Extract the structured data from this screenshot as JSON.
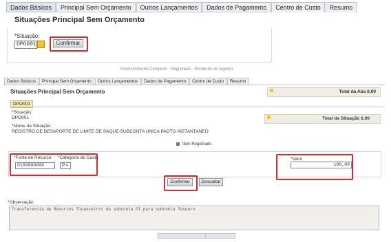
{
  "top": {
    "tabs": [
      "Dados Básicos",
      "Principal Sem Orçamento",
      "Outros Lançamentos",
      "Dados de Pagamento",
      "Centro de Custo",
      "Resumo"
    ],
    "title": "Situações Principal Sem Orçamento",
    "situacao_label": "Situação:",
    "situacao_value": "DPO001",
    "confirm_label": "Confirmar"
  },
  "middle_text": "Preenchimento Completo  ·  Registrado  ·  Pendente de registro",
  "bottom": {
    "tabs": [
      "Dados Básicos",
      "Principal Sem Orçamento",
      "Outros Lançamentos",
      "Dados de Pagamento",
      "Centro de Custo",
      "Resumo"
    ],
    "title": "Situações Principal Sem Orçamento",
    "total_aba": "Total da Aba 0,00",
    "subtab": "DPO001",
    "situacao_label": "Situação:",
    "situacao_value": "DPO001",
    "nome_label": "Nome da Situação:",
    "nome_value": "REGISTRO DE DESAPORTE DE LIMITE DE SAQUE-SUBCONTA UNICA PAGTO INSTANTANEO",
    "total_situacao": "Total da Situação 0,00",
    "item_registrado": "Item Registrado",
    "fonte_label": "Fonte de Recurso",
    "fonte_value": "0100000000",
    "categoria_label": "Categoria de Gasto",
    "categoria_value": "P",
    "valor_label": "Valor",
    "valor_value": "100,00",
    "confirm_label": "Confirmar",
    "descartar_label": "Descartar",
    "observacao_label": "Observação",
    "observacao_value": "Transferencia de Recursos financeiros da subconta PI para subconta Tesouro"
  },
  "colors": {
    "highlight": "#d62b2b",
    "lookup": "#f1c232"
  }
}
